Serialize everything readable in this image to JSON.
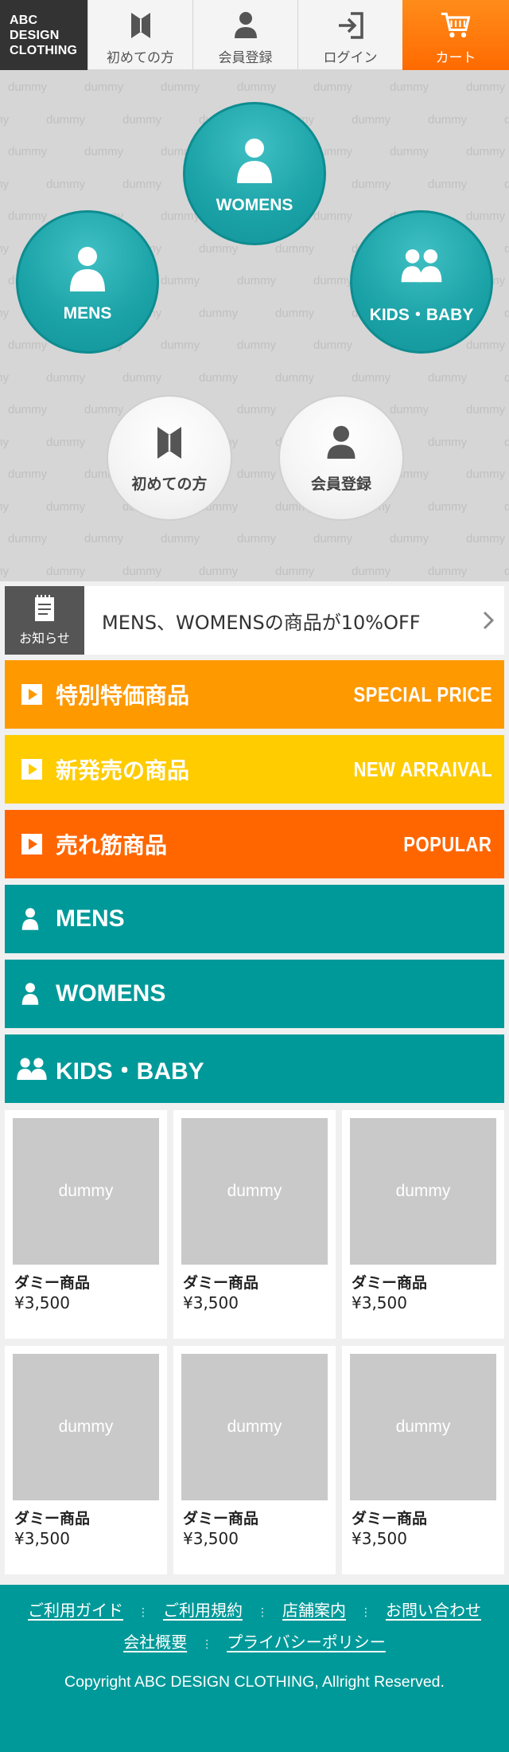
{
  "header": {
    "logo_lines": [
      "ABC",
      "DESIGN",
      "CLOTHING"
    ],
    "nav": [
      {
        "label": "初めての方",
        "icon": "bookmark-icon"
      },
      {
        "label": "会員登録",
        "icon": "user-icon"
      },
      {
        "label": "ログイン",
        "icon": "login-icon"
      },
      {
        "label": "カート",
        "icon": "cart-icon"
      }
    ]
  },
  "hero": {
    "pattern_text": "dummy",
    "categories": [
      {
        "label": "WOMENS",
        "icon": "person-icon"
      },
      {
        "label": "MENS",
        "icon": "person-icon"
      },
      {
        "label": "KIDS・BABY",
        "icon": "two-persons-icon"
      }
    ],
    "quick_links": [
      {
        "label": "初めての方",
        "icon": "bookmark-icon"
      },
      {
        "label": "会員登録",
        "icon": "user-icon"
      }
    ]
  },
  "notice": {
    "tag": "お知らせ",
    "text": "MENS、WOMENSの商品が10%OFF"
  },
  "bars": [
    {
      "label": "特別特価商品",
      "en": "SPECIAL PRICE",
      "color": "#ff9900",
      "icon": "play-icon"
    },
    {
      "label": "新発売の商品",
      "en": "NEW ARRAIVAL",
      "color": "#ffcc00",
      "icon": "play-icon"
    },
    {
      "label": "売れ筋商品",
      "en": "POPULAR",
      "color": "#ff6600",
      "icon": "play-icon"
    },
    {
      "label": "MENS",
      "en": "",
      "color": "#009999",
      "icon": "person-icon"
    },
    {
      "label": "WOMENS",
      "en": "",
      "color": "#009999",
      "icon": "person-icon"
    },
    {
      "label": "KIDS・BABY",
      "en": "",
      "color": "#009999",
      "icon": "two-persons-icon"
    }
  ],
  "products": [
    {
      "thumb": "dummy",
      "name": "ダミー商品",
      "price": "¥3,500"
    },
    {
      "thumb": "dummy",
      "name": "ダミー商品",
      "price": "¥3,500"
    },
    {
      "thumb": "dummy",
      "name": "ダミー商品",
      "price": "¥3,500"
    },
    {
      "thumb": "dummy",
      "name": "ダミー商品",
      "price": "¥3,500"
    },
    {
      "thumb": "dummy",
      "name": "ダミー商品",
      "price": "¥3,500"
    },
    {
      "thumb": "dummy",
      "name": "ダミー商品",
      "price": "¥3,500"
    }
  ],
  "footer": {
    "links": [
      "ご利用ガイド",
      "ご利用規約",
      "店舗案内",
      "お問い合わせ",
      "会社概要",
      "プライバシーポリシー"
    ],
    "copyright": "Copyright ABC DESIGN CLOTHING, Allright Reserved."
  },
  "colors": {
    "teal": "#009999",
    "orange": "#ff9900",
    "yellow": "#ffcc00",
    "red_orange": "#ff6600",
    "cart": "#ff7700"
  }
}
